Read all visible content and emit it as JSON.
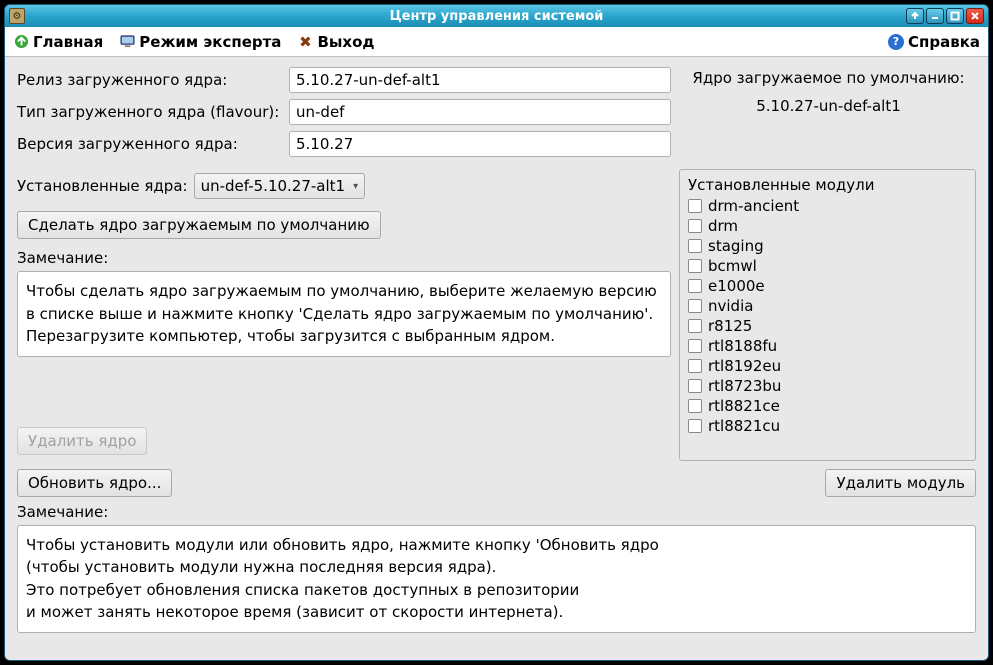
{
  "window": {
    "title": "Центр управления системой"
  },
  "toolbar": {
    "home": "Главная",
    "expert": "Режим эксперта",
    "exit": "Выход",
    "help": "Справка"
  },
  "kernel_info": {
    "release_label": "Релиз загруженного ядра:",
    "release_value": "5.10.27-un-def-alt1",
    "flavour_label": "Тип загруженного ядра (flavour):",
    "flavour_value": "un-def",
    "version_label": "Версия загруженного ядра:",
    "version_value": "5.10.27"
  },
  "default_kernel": {
    "heading": "Ядро загружаемое по умолчанию:",
    "value": "5.10.27-un-def-alt1"
  },
  "installed_kernels": {
    "label": "Установленные ядра:",
    "selected": "un-def-5.10.27-alt1"
  },
  "buttons": {
    "make_default": "Сделать ядро загружаемым по умолчанию",
    "remove_kernel": "Удалить ядро",
    "update_kernel": "Обновить ядро...",
    "remove_module": "Удалить модуль"
  },
  "notes": {
    "label": "Замечание:",
    "note1_l1": "Чтобы сделать ядро загружаемым по умолчанию, выберите желаемую версию",
    "note1_l2": "в списке выше и нажмите кнопку 'Сделать ядро загружаемым по умолчанию'.",
    "note1_l3": "Перезагрузите компьютер, чтобы загрузится с выбранным ядром.",
    "note2_l1": "Чтобы установить модули или обновить ядро, нажмите кнопку 'Обновить ядро",
    "note2_l2": "(чтобы установить модули нужна последняя версия ядра).",
    "note2_l3": "Это потребует обновления списка пакетов доступных в репозитории",
    "note2_l4": "и может занять некоторое время (зависит от скорости интернета)."
  },
  "modules": {
    "title": "Установленные модули",
    "items": [
      "drm-ancient",
      "drm",
      "staging",
      "bcmwl",
      "e1000e",
      "nvidia",
      "r8125",
      "rtl8188fu",
      "rtl8192eu",
      "rtl8723bu",
      "rtl8821ce",
      "rtl8821cu"
    ]
  }
}
